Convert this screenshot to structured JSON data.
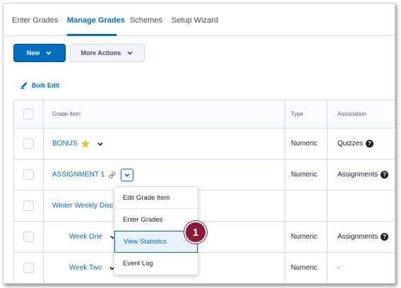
{
  "tabs": [
    {
      "label": "Enter Grades"
    },
    {
      "label": "Manage Grades"
    },
    {
      "label": "Schemes"
    },
    {
      "label": "Setup Wizard"
    }
  ],
  "toolbar": {
    "new_label": "New",
    "more_actions_label": "More Actions"
  },
  "bulk_edit_label": "Bulk Edit",
  "table": {
    "headers": {
      "grade_item": "Grade Item",
      "type": "Type",
      "association": "Association"
    },
    "rows": [
      {
        "name": "BONUS",
        "type": "Numeric",
        "association": "Quizzes"
      },
      {
        "name": "ASSIGNMENT 1",
        "type": "Numeric",
        "association": "Assignments"
      },
      {
        "name": "Winter Weekly Discu",
        "type": "",
        "association": ""
      },
      {
        "name": "Week One",
        "type": "Numeric",
        "association": "Assignments"
      },
      {
        "name": "Week Two",
        "type": "Numeric",
        "association": "-"
      }
    ]
  },
  "menu": {
    "items": [
      {
        "label": "Edit Grade Item"
      },
      {
        "label": "Enter Grades"
      },
      {
        "label": "View Statistics"
      },
      {
        "label": "Event Log"
      }
    ]
  },
  "callout": {
    "number": "1"
  },
  "colors": {
    "primary": "#006fbf",
    "callout": "#8b1a3a",
    "star": "#f2c811"
  }
}
